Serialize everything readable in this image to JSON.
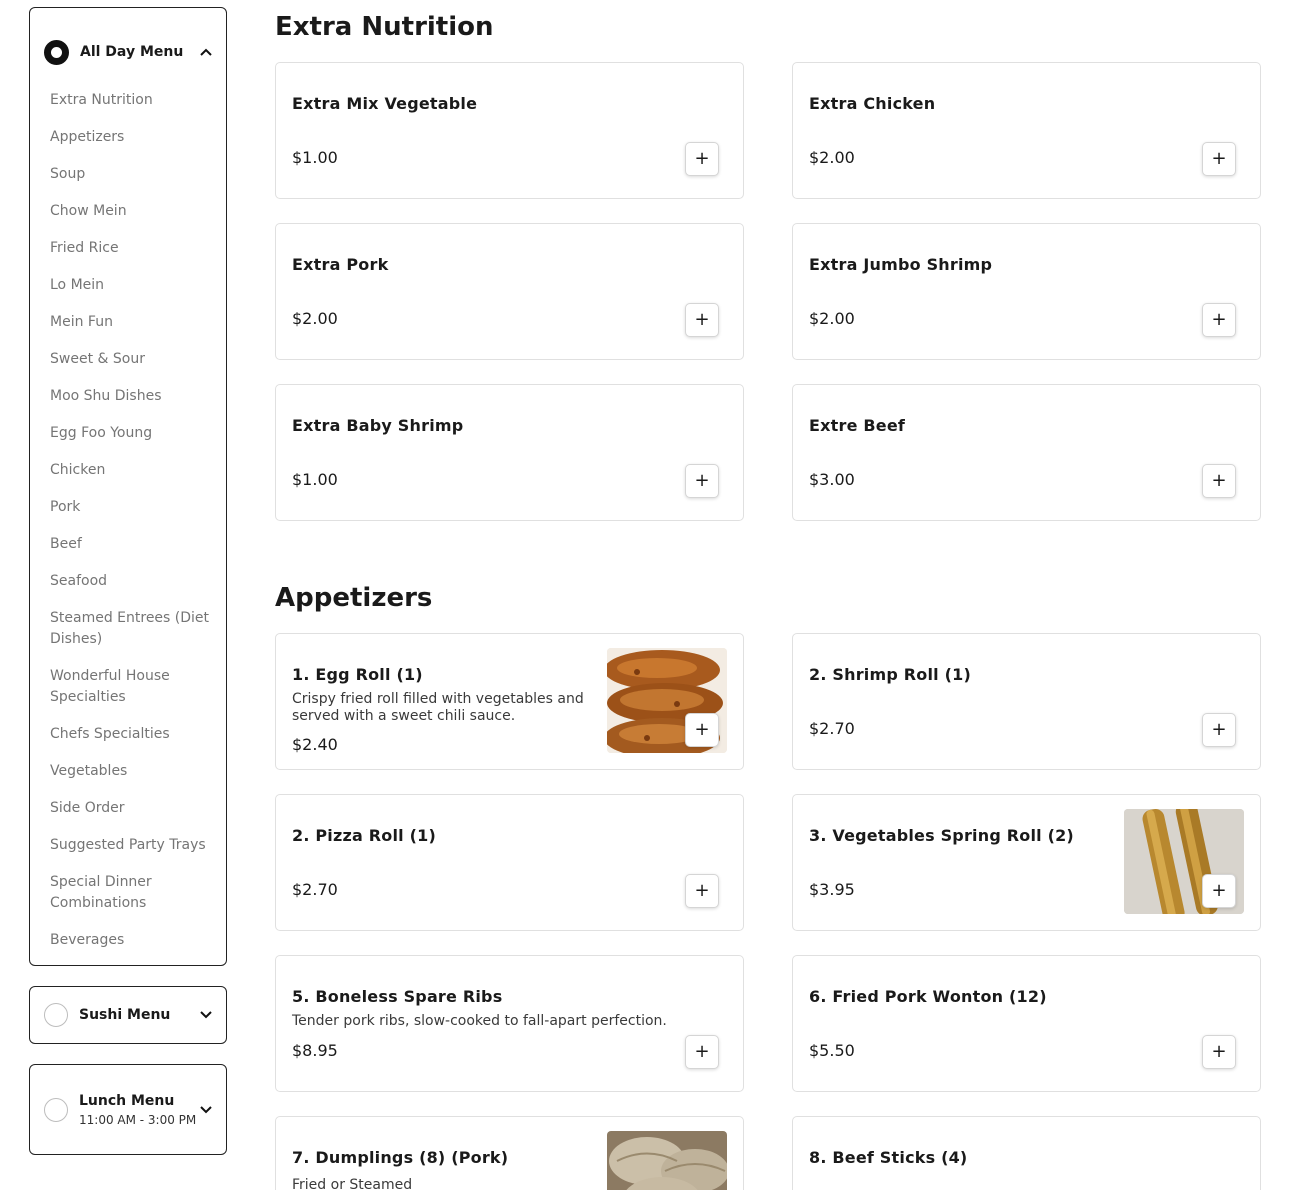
{
  "sidebar": {
    "all_day": {
      "title": "All Day Menu",
      "categories": [
        "Extra Nutrition",
        "Appetizers",
        "Soup",
        "Chow Mein",
        "Fried Rice",
        "Lo Mein",
        "Mein Fun",
        "Sweet & Sour",
        "Moo Shu Dishes",
        "Egg Foo Young",
        "Chicken",
        "Pork",
        "Beef",
        "Seafood",
        "Steamed Entrees (Diet Dishes)",
        "Wonderful House Specialties",
        "Chefs Specialties",
        "Vegetables",
        "Side Order",
        "Suggested Party Trays",
        "Special Dinner Combinations",
        "Beverages"
      ]
    },
    "sushi": {
      "title": "Sushi Menu"
    },
    "lunch": {
      "title": "Lunch Menu",
      "hours": "11:00 AM - 3:00 PM"
    }
  },
  "sections": {
    "extra": {
      "title": "Extra Nutrition",
      "items": [
        {
          "name": "Extra Mix Vegetable",
          "price": "$1.00"
        },
        {
          "name": "Extra Chicken",
          "price": "$2.00"
        },
        {
          "name": "Extra Pork",
          "price": "$2.00"
        },
        {
          "name": "Extra Jumbo Shrimp",
          "price": "$2.00"
        },
        {
          "name": "Extra Baby Shrimp",
          "price": "$1.00"
        },
        {
          "name": "Extre Beef",
          "price": "$3.00"
        }
      ]
    },
    "appetizers": {
      "title": "Appetizers",
      "items": [
        {
          "name": "1. Egg Roll (1)",
          "desc": "Crispy fried roll filled with vegetables and served with a sweet chili sauce.",
          "price": "$2.40"
        },
        {
          "name": "2. Shrimp Roll (1)",
          "price": "$2.70"
        },
        {
          "name": "2. Pizza Roll (1)",
          "price": "$2.70"
        },
        {
          "name": "3. Vegetables Spring Roll (2)",
          "price": "$3.95"
        },
        {
          "name": "5. Boneless Spare Ribs",
          "desc": "Tender pork ribs, slow-cooked to fall-apart perfection.",
          "price": "$8.95"
        },
        {
          "name": "6. Fried Pork Wonton (12)",
          "price": "$5.50"
        },
        {
          "name": "7. Dumplings (8) (Pork)",
          "desc": "Fried or Steamed"
        },
        {
          "name": "8. Beef Sticks (4)"
        }
      ]
    }
  },
  "add_label": "+",
  "colors": {
    "text": "#1a1a1a",
    "muted": "#757575",
    "border": "#e0e0e0"
  }
}
